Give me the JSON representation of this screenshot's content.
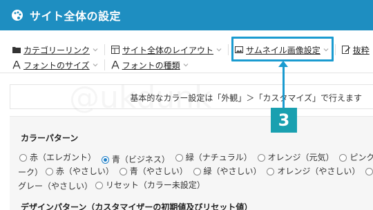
{
  "header": {
    "title": "サイト全体の設定",
    "icon": "palette-icon"
  },
  "nav": {
    "row1": [
      {
        "label": "カテゴリーリンク",
        "icon": "folder-icon"
      },
      {
        "label": "サイト全体のレイアウト",
        "icon": "layout-icon"
      },
      {
        "label": "サムネイル画像設定",
        "icon": "image-icon"
      },
      {
        "label": "抜粋",
        "icon": "edit-icon"
      }
    ],
    "row2": [
      {
        "label": "フォントのサイズ",
        "icon": "font-size-icon"
      },
      {
        "label": "フォントの種類",
        "icon": "font-type-icon"
      }
    ]
  },
  "callout": {
    "step_number": "3",
    "color": "#1a9bd0"
  },
  "notice": {
    "text": "基本的なカラー設定は「外観」＞「カスタマイズ」で行えます"
  },
  "watermark": {
    "text": "@ukdunk"
  },
  "color_pattern": {
    "title": "カラーパターン",
    "line1": [
      {
        "label": "赤（エレガント）",
        "selected": false
      },
      {
        "label": "青（ビジネス）",
        "selected": true
      },
      {
        "label": "緑（ナチュラル）",
        "selected": false
      },
      {
        "label": "オレンジ（元気）",
        "selected": false
      },
      {
        "label": "ピンク",
        "selected": false
      }
    ],
    "line2_prefix": "ーク）",
    "line2": [
      {
        "label": "赤（やさしい）",
        "selected": false
      },
      {
        "label": "青（やさしい）",
        "selected": false
      },
      {
        "label": "緑（やさしい）",
        "selected": false
      },
      {
        "label": "オレンジ（やさしい）",
        "selected": false
      },
      {
        "label": "",
        "selected": false
      }
    ],
    "line3_prefix": "グレー（やさしい）",
    "line3": [
      {
        "label": "リセット（カラー未設定）",
        "selected": false
      }
    ]
  },
  "design_pattern": {
    "title": "デザインパターン（カスタマイザーの初期値及びリセット値）"
  },
  "colors": {
    "header_bg": "#1e8ec1",
    "accent": "#1a9bd0",
    "badge": "#1aa0b0"
  }
}
